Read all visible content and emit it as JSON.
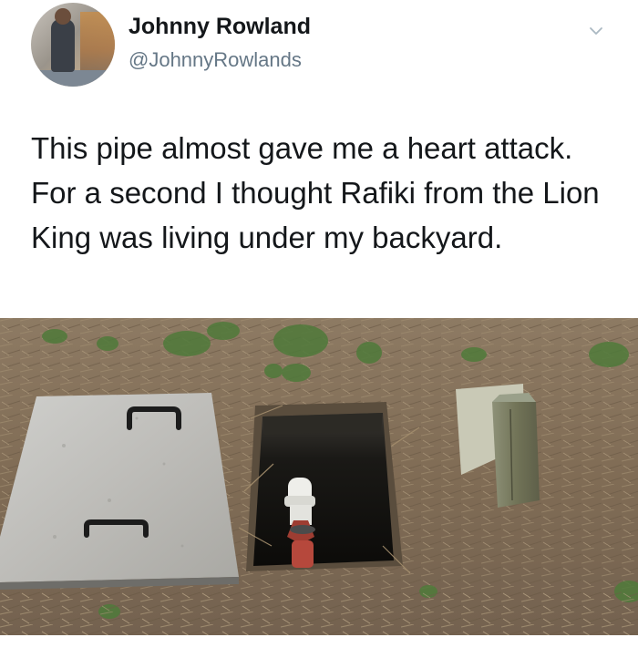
{
  "tweet": {
    "author_name": "Johnny Rowland",
    "author_handle": "@JohnnyRowlands",
    "text": "This pipe almost gave me a heart attack. For a second I thought Rafiki from the Lion King was living under my backyard.",
    "more_icon": "chevron-down-icon"
  },
  "photo": {
    "subject": "pipe-in-ground-box"
  },
  "colors": {
    "name": "#14171a",
    "handle": "#657786",
    "text": "#14171a",
    "chevron": "#aab8c2"
  }
}
